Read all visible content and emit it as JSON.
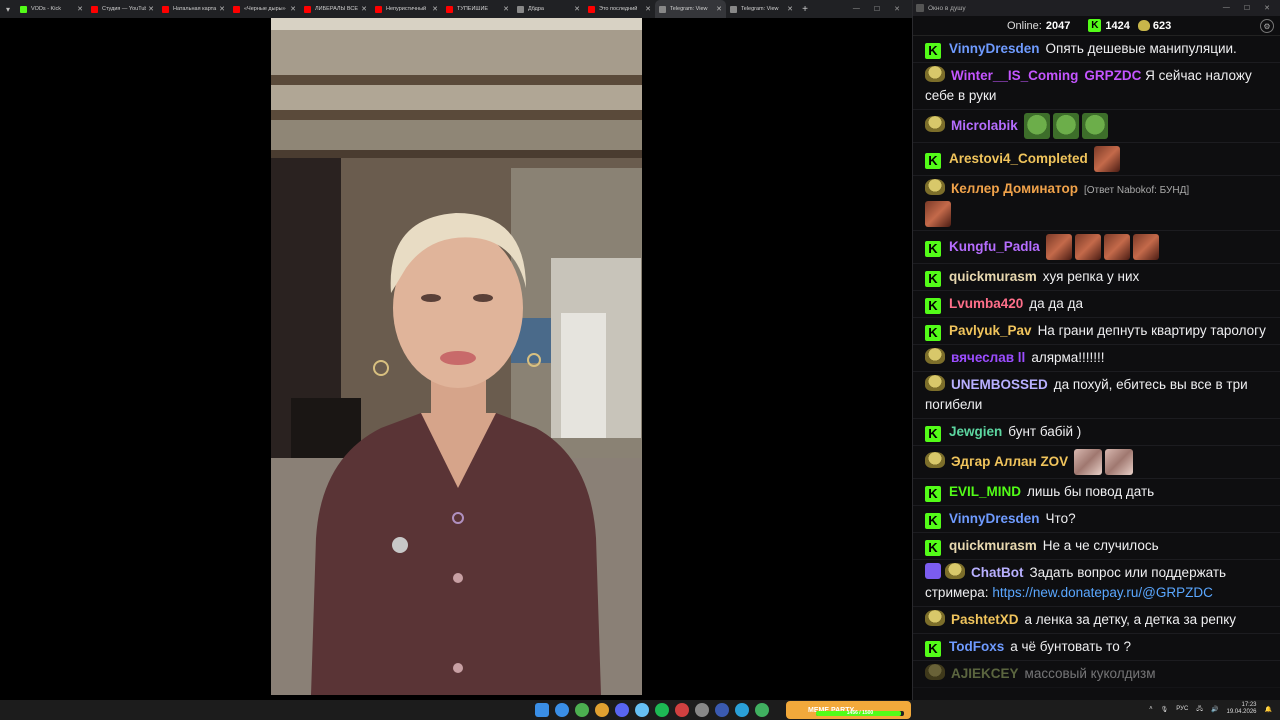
{
  "browser": {
    "tabs": [
      {
        "title": "VODs - Kick",
        "color": "#53fc18",
        "active": false
      },
      {
        "title": "Студия — YouTube",
        "color": "#ff0000",
        "active": false
      },
      {
        "title": "Натальная карта",
        "color": "#ff0000",
        "active": false
      },
      {
        "title": "«Черные дыры»",
        "color": "#ff0000",
        "active": false
      },
      {
        "title": "ЛИБЕРАЛЫ ВСЁ",
        "color": "#ff0000",
        "active": false
      },
      {
        "title": "Непуристичный",
        "color": "#ff0000",
        "active": false
      },
      {
        "title": "ТУПЕЙШИЕ",
        "color": "#ff0000",
        "active": false
      },
      {
        "title": "Дбдра",
        "color": "#888888",
        "active": false
      },
      {
        "title": "Это последний",
        "color": "#ff0000",
        "active": false
      },
      {
        "title": "Telegram: View",
        "color": "#888888",
        "active": true
      },
      {
        "title": "Telegram: View",
        "color": "#888888",
        "active": false
      }
    ]
  },
  "chat": {
    "window_title": "Окно в душу",
    "online_label": "Online:",
    "online_count": "2047",
    "stat_k": "1424",
    "stat_pepe": "623",
    "messages": [
      {
        "badge": "k",
        "user": "VinnyDresden",
        "color": "#6f9bff",
        "text": "Опять дешевые манипуляции."
      },
      {
        "badge": "pepe",
        "user": "Winter__IS_Coming",
        "color": "#c455ff",
        "text": "GRPZDC Я сейчас наложу себе в руки",
        "prefix": "GRPZDC",
        "prefix_color": "#c455ff"
      },
      {
        "badge": "pepe",
        "user": "Microlabik",
        "color": "#b66dff",
        "emotes": [
          "pepe",
          "pepe",
          "pepe"
        ]
      },
      {
        "badge": "k",
        "user": "Arestovi4_Completed",
        "color": "#f0c45c",
        "emotes": [
          "face"
        ]
      },
      {
        "badge": "pepe",
        "user": "Келлер Доминатор",
        "color": "#f0a24a",
        "reply": "[Ответ Nabokof: БУНД]",
        "emotes": [
          "face"
        ]
      },
      {
        "badge": "k",
        "user": "Kungfu_Padla",
        "color": "#b66dff",
        "emotes": [
          "face",
          "face",
          "face",
          "face"
        ]
      },
      {
        "badge": "k",
        "user": "quickmurasm",
        "color": "#e8d8b0",
        "text": "хуя репка у них"
      },
      {
        "badge": "k",
        "user": "Lvumba420",
        "color": "#ff6f8a",
        "text": "да да да"
      },
      {
        "badge": "k",
        "user": "Pavlyuk_Pav",
        "color": "#f0c45c",
        "text": "На грани депнуть квартиру тарологу"
      },
      {
        "badge": "pepe",
        "user": "вячеслав ll",
        "color": "#9b4dff",
        "text": "алярма!!!!!!!"
      },
      {
        "badge": "pepe",
        "user": "UNEMBOSSED",
        "color": "#b8b0ff",
        "text": "да похуй, ебитесь вы все в три погибели"
      },
      {
        "badge": "k",
        "user": "Jewgien",
        "color": "#5cd6a0",
        "text": "бунт бабій )"
      },
      {
        "badge": "pepe",
        "user": "Эдгар Аллан ZOV",
        "color": "#f0c45c",
        "emotes": [
          "girl",
          "girl"
        ]
      },
      {
        "badge": "k",
        "user": "EVIL_MIND",
        "color": "#53fc18",
        "text": "лишь бы повод дать"
      },
      {
        "badge": "k",
        "user": "VinnyDresden",
        "color": "#6f9bff",
        "text": "Что?"
      },
      {
        "badge": "k",
        "user": "quickmurasm",
        "color": "#e8d8b0",
        "text": "Не а че случилось"
      },
      {
        "badge": "bot",
        "user": "ChatBot",
        "color": "#b8b0ff",
        "text": "Задать вопрос или поддержать стримера:",
        "link": "https://new.donatepay.ru/@GRPZDC"
      },
      {
        "badge": "pepe",
        "user": "PashtetXD",
        "color": "#f0c45c",
        "text": "а ленка за детку, а детка за репку"
      },
      {
        "badge": "k",
        "user": "TodFoxs",
        "color": "#6f9bff",
        "text": "а чё бунтовать то ?"
      },
      {
        "badge": "pepe",
        "user": "AJIEKCEY",
        "color": "#b8d078",
        "text": "массовый куколдизм",
        "faded": true
      }
    ]
  },
  "taskbar": {
    "meme_label": "MEME PARTY",
    "meme_progress_text": "1456 / 1500",
    "meme_progress": 0.97,
    "lang": "РУС",
    "time": "17:23",
    "date": "19.04.2026",
    "icons": [
      "#3a8ee6",
      "#4caf50",
      "#e0a030",
      "#5865f2",
      "#66c0f4",
      "#1db954",
      "#d04040",
      "#888888",
      "#3a5ab0",
      "#2aa0d8",
      "#40b060"
    ]
  }
}
